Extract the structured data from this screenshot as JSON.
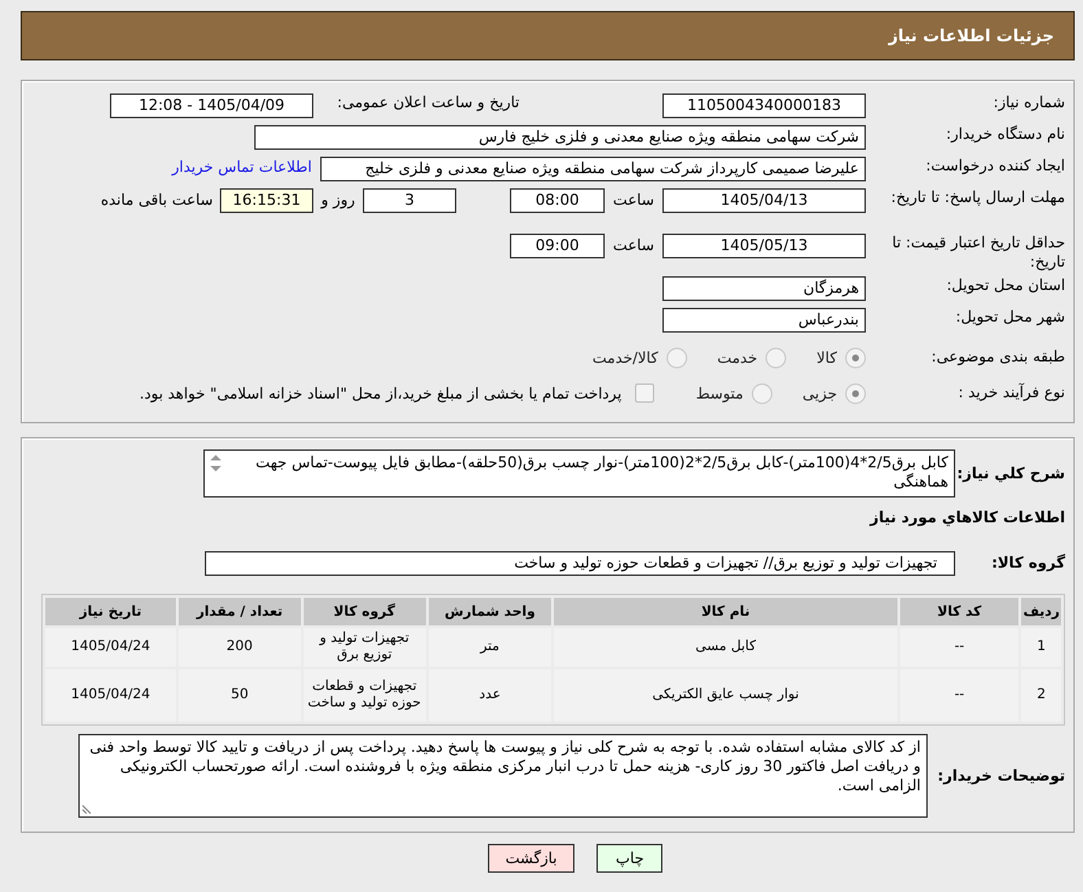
{
  "header": {
    "title": "جزئیات اطلاعات نیاز"
  },
  "need_number": {
    "label": "شماره نیاز:",
    "value": "1105004340000183"
  },
  "announce_datetime": {
    "label": "تاریخ و ساعت اعلان عمومی:",
    "value": "1405/04/09 - 12:08"
  },
  "buyer_org": {
    "label": "نام دستگاه خریدار:",
    "value": "شرکت سهامی منطقه ویژه صنایع معدنی و فلزی خلیج فارس"
  },
  "requester": {
    "label": "ایجاد کننده درخواست:",
    "value": "علیرضا صمیمی کارپرداز شرکت سهامی منطقه ویژه صنایع معدنی و فلزی خلیج",
    "link": "اطلاعات تماس خریدار"
  },
  "reply_deadline": {
    "label": "مهلت ارسال پاسخ: تا تاریخ:",
    "date": "1405/04/13",
    "time_label": "ساعت",
    "time": "08:00",
    "days": "3",
    "days_label": "روز و",
    "remaining": "16:15:31",
    "remaining_label": "ساعت باقی مانده"
  },
  "price_validity": {
    "label": "حداقل تاریخ اعتبار قیمت: تا تاریخ:",
    "date": "1405/05/13",
    "time_label": "ساعت",
    "time": "09:00"
  },
  "delivery_province": {
    "label": "استان محل تحویل:",
    "value": "هرمزگان"
  },
  "delivery_city": {
    "label": "شهر محل تحویل:",
    "value": "بندرعباس"
  },
  "category": {
    "label": "طبقه بندی موضوعی:",
    "options": [
      {
        "label": "کالا",
        "selected": true
      },
      {
        "label": "خدمت",
        "selected": false
      },
      {
        "label": "کالا/خدمت",
        "selected": false
      }
    ]
  },
  "process": {
    "label": "نوع فرآیند خرید :",
    "options": [
      {
        "label": "جزیی",
        "selected": true
      },
      {
        "label": "متوسط",
        "selected": false
      }
    ],
    "checkbox": {
      "label": "پرداخت تمام یا بخشی از مبلغ خرید،از محل \"اسناد خزانه اسلامی\" خواهد بود.",
      "checked": false
    }
  },
  "description": {
    "label": "شرح کلي نياز:",
    "value": "کابل برق2/5*4(100متر)-کابل برق2/5*2(100متر)-نوار چسب برق(50حلقه)-مطابق فایل پیوست-تماس جهت هماهنگی"
  },
  "items_heading": "اطلاعات كالاهاي مورد نياز",
  "goods_group": {
    "label": "گروه کالا:",
    "value": "تجهیزات تولید و توزیع برق// تجهیزات و قطعات حوزه تولید و ساخت"
  },
  "table": {
    "columns": [
      "ردیف",
      "کد کالا",
      "نام کالا",
      "واحد شمارش",
      "گروه کالا",
      "تعداد / مقدار",
      "تاریخ نیاز"
    ],
    "rows": [
      [
        "1",
        "--",
        "کابل مسی",
        "متر",
        "تجهیزات تولید و توزیع برق",
        "200",
        "1405/04/24"
      ],
      [
        "2",
        "--",
        "نوار چسب عایق الکتریکی",
        "عدد",
        "تجهیزات و قطعات حوزه تولید و ساخت",
        "50",
        "1405/04/24"
      ]
    ]
  },
  "buyer_notes": {
    "label": "توضیحات خریدار:",
    "value": "از کد کالای مشابه استفاده شده. با توجه به شرح کلی نیاز و پیوست ها پاسخ دهید. پرداخت پس از دریافت و تایید کالا توسط واحد فنی و دریافت اصل فاکتور 30 روز کاری- هزینه حمل تا درب انبار مرکزی منطقه ویژه با فروشنده است. ارائه صورتحساب الکترونیکی الزامی است."
  },
  "buttons": [
    {
      "label": "چاپ",
      "kind": "print"
    },
    {
      "label": "بازگشت",
      "kind": "back"
    }
  ]
}
